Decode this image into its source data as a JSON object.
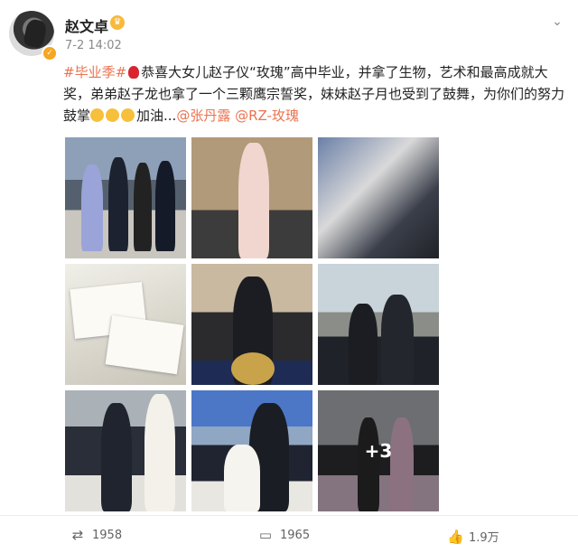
{
  "post": {
    "author": "赵文卓",
    "time": "7-2 14:02",
    "text_parts": {
      "hashtag": "#毕业季#",
      "body1": "恭喜大女儿赵子仪“玫瑰”高中毕业，并拿了生物，艺术和最高成就大奖，弟弟赵子龙也拿了一个三颗鹰宗誓奖，妹妹赵子月也受到了鼓舞，为你们的努力鼓掌",
      "body2": "加油...",
      "mention1": "@张丹露",
      "mention2": "@RZ-玫瑰"
    },
    "more_photos": "+3"
  },
  "actions": {
    "repost_count": "1958",
    "comment_count": "1965",
    "like_count": "1.9万"
  },
  "icons": {
    "more": "chevron-down-icon",
    "repost": "repost-icon",
    "comment": "comment-icon",
    "like": "thumbs-up-icon",
    "verified": "verified-badge-icon",
    "crown": "crown-icon"
  },
  "colors": {
    "accent": "#eb7350",
    "text": "#222222",
    "muted": "#8a8a8a"
  }
}
